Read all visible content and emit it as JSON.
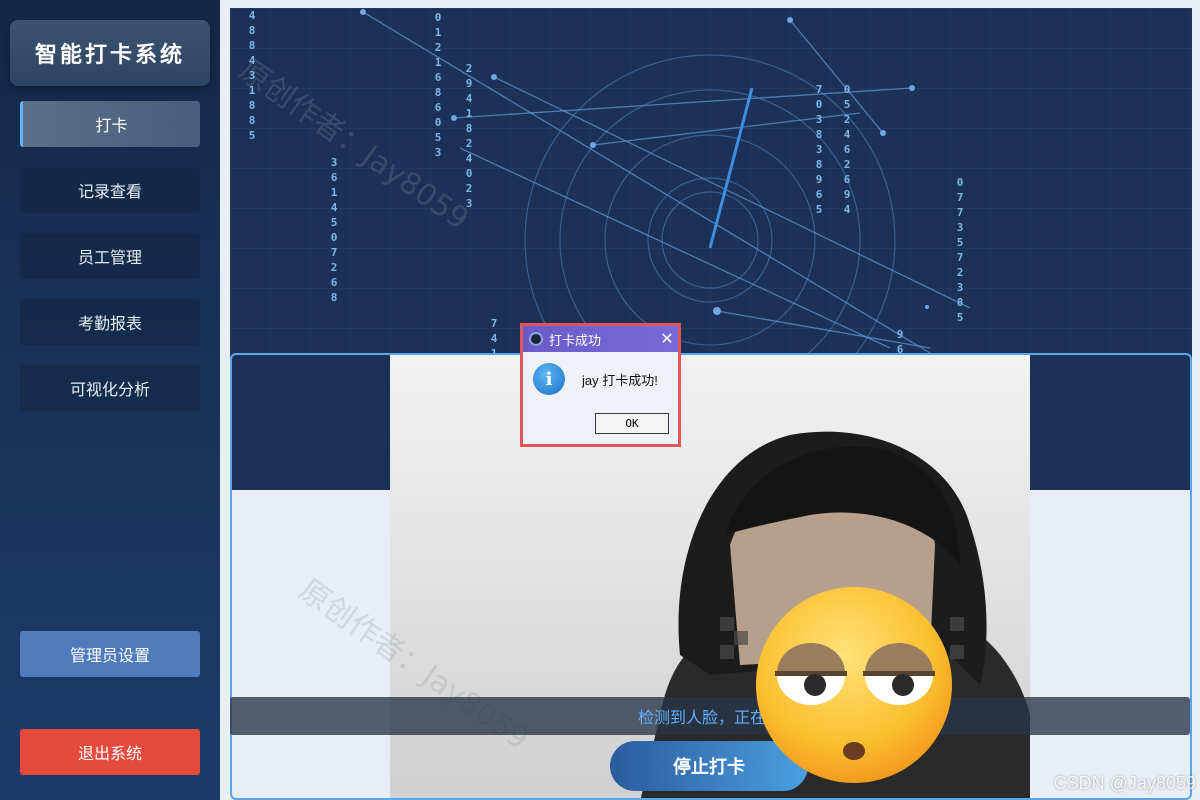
{
  "app": {
    "title": "智能打卡系统"
  },
  "sidebar": {
    "items": [
      {
        "label": "打卡",
        "active": true
      },
      {
        "label": "记录查看",
        "active": false
      },
      {
        "label": "员工管理",
        "active": false
      },
      {
        "label": "考勤报表",
        "active": false
      },
      {
        "label": "可视化分析",
        "active": false
      }
    ],
    "admin_label": "管理员设置",
    "exit_label": "退出系统"
  },
  "banner": {
    "digit_columns": [
      "4\n8\n8\n4\n3\n1\n8\n8\n5",
      "0\n1\n2\n1\n6\n8\n6\n0\n5\n3",
      "2\n9\n4\n1\n8\n2\n4\n0\n2\n3",
      "3\n6\n1\n4\n5\n0\n7\n2\n6\n8",
      "7\n0\n3\n8\n3\n8\n9\n6\n5",
      "0\n5\n2\n4\n6\n2\n6\n9\n4",
      "0\n7\n7\n3\n5\n7\n2\n3\n8\n5",
      "7\n4\n1",
      "9\n6"
    ]
  },
  "camera": {
    "status_text": "检测到人脸，正在识",
    "stop_label": "停止打卡"
  },
  "dialog": {
    "title": "打卡成功",
    "message": "jay 打卡成功!",
    "ok_label": "OK",
    "close_icon": "close-icon",
    "type_icon": "info-icon"
  },
  "watermarks": {
    "text_a": "原创作者：Jay8059",
    "text_b": "原创作者：Jay8059",
    "csdn": "CSDN @Jay8059"
  },
  "colors": {
    "accent": "#63b3ff",
    "sidebar_bg": "#19355e",
    "exit_red": "#e44b3c",
    "admin_blue": "#4f7bbd",
    "dialog_border": "#e2555a",
    "dialog_title": "#6a5bc8"
  }
}
